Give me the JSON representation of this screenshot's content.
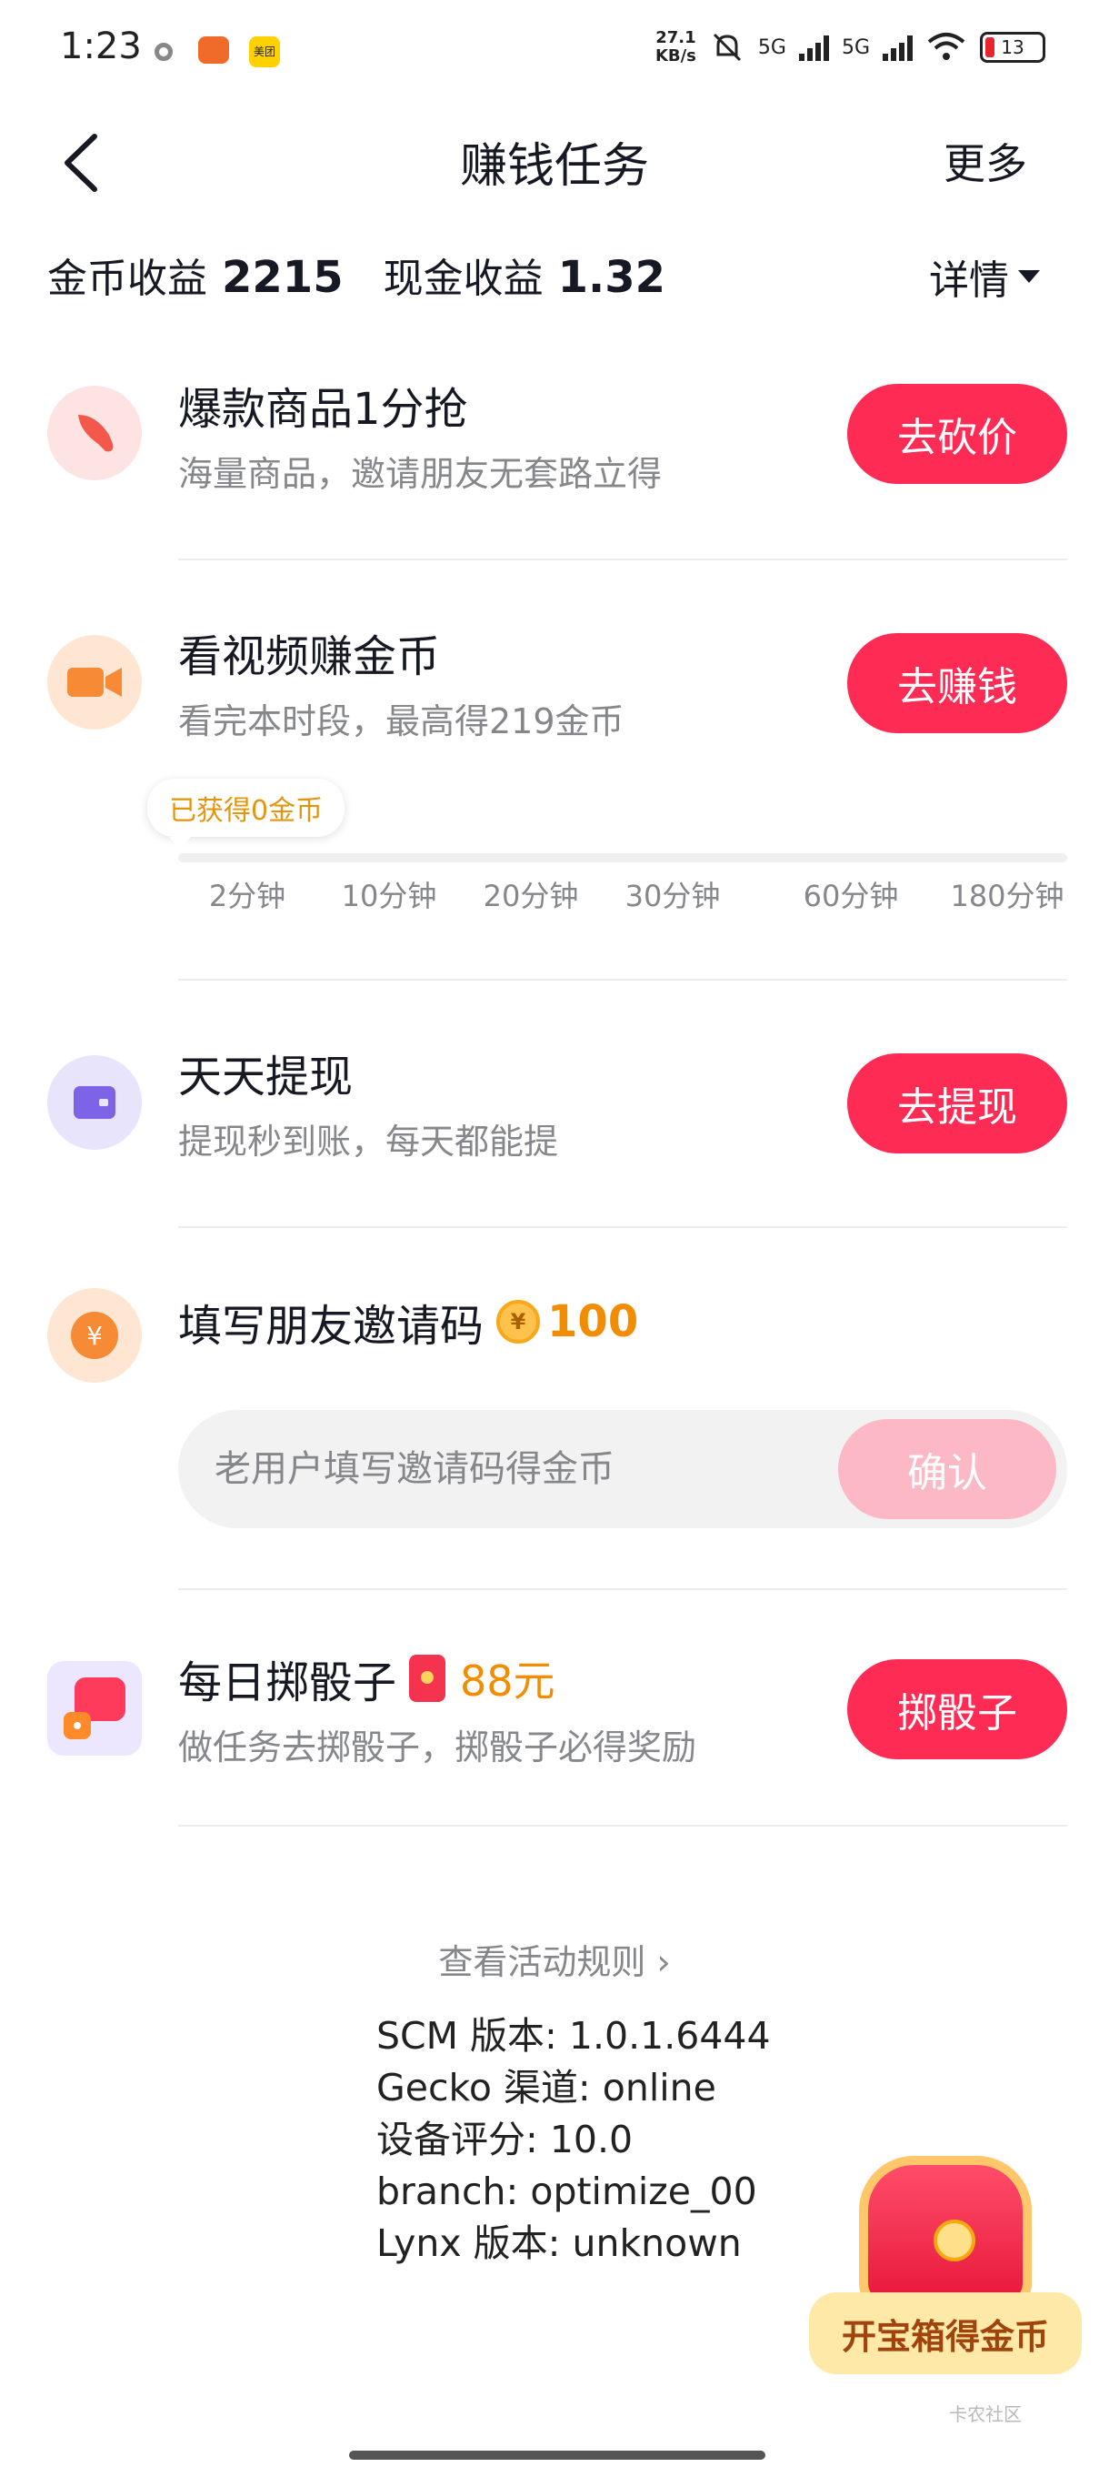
{
  "status_bar": {
    "time": "1:23",
    "net_speed_top": "27.1",
    "net_speed_bottom": "KB/s",
    "net1": "5G",
    "net2": "5G",
    "battery": "13",
    "app2_label": "美团"
  },
  "nav": {
    "title": "赚钱任务",
    "more": "更多"
  },
  "earnings": {
    "coin_label": "金币收益",
    "coin_value": "2215",
    "cash_label": "现金收益",
    "cash_value": "1.32",
    "details": "详情"
  },
  "tasks": [
    {
      "title": "爆款商品1分抢",
      "desc": "海量商品，邀请朋友无套路立得",
      "button": "去砍价",
      "icon": "knife-icon"
    },
    {
      "title": "看视频赚金币",
      "desc": "看完本时段，最高得219金币",
      "button": "去赚钱",
      "icon": "video-camera-icon"
    },
    {
      "title": "天天提现",
      "desc": "提现秒到账，每天都能提",
      "button": "去提现",
      "icon": "wallet-icon"
    },
    {
      "title": "填写朋友邀请码",
      "reward": "100",
      "input_placeholder": "老用户填写邀请码得金币",
      "button": "确认",
      "icon": "yuan-icon"
    },
    {
      "title": "每日掷骰子",
      "reward": "88元",
      "desc": "做任务去掷骰子，掷骰子必得奖励",
      "button": "掷骰子",
      "icon": "dice-icon"
    }
  ],
  "video_progress": {
    "earned": "已获得0金币",
    "fraction": 0,
    "ticks": [
      "2分钟",
      "10分钟",
      "20分钟",
      "30分钟",
      "60分钟",
      "180分钟"
    ]
  },
  "footer": {
    "rules_link": "查看活动规则",
    "info_lines": [
      "SCM 版本: 1.0.1.6444",
      "Gecko 渠道: online",
      "设备评分: 10.0",
      "branch: optimize_00",
      "Lynx 版本: unknown"
    ],
    "treasure_label": "开宝箱得金币",
    "watermark": "卡农社区"
  },
  "colors": {
    "accent": "#fe2c55",
    "coin": "#f28c00",
    "muted_text": "#86878b"
  }
}
